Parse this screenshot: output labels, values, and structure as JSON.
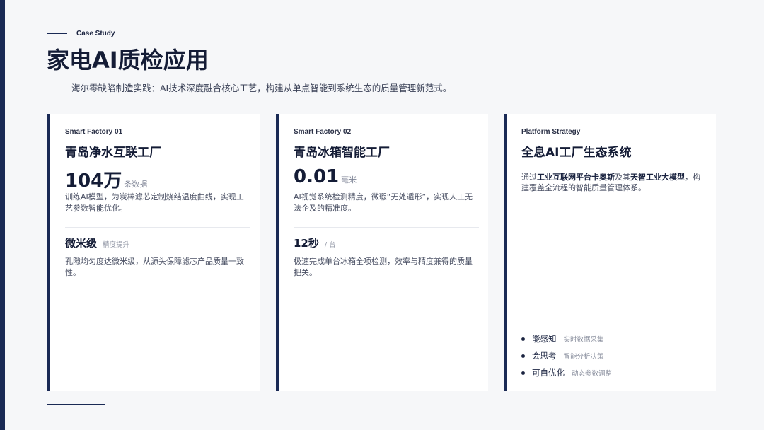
{
  "header": {
    "eyebrow": "Case Study",
    "title": "家电AI质检应用",
    "subtitle": "海尔零缺陷制造实践：AI技术深度融合核心工艺，构建从单点智能到系统生态的质量管理新范式。"
  },
  "cards": [
    {
      "label": "Smart Factory 01",
      "title": "青岛净水互联工厂",
      "metric_value": "104万",
      "metric_unit": "条数据",
      "description": "训练AI模型，为炭棒滤芯定制烧结温度曲线，实现工艺参数智能优化。",
      "metric2_value": "微米级",
      "metric2_unit": "精度提升",
      "description2": "孔隙均匀度达微米级，从源头保障滤芯产品质量一致性。"
    },
    {
      "label": "Smart Factory 02",
      "title": "青岛冰箱智能工厂",
      "metric_value": "0.01",
      "metric_unit": "毫米",
      "description": "AI视觉系统检测精度，微瑕“无处遁形”，实现人工无法企及的精准度。",
      "metric2_value": "12秒",
      "metric2_unit": "/ 台",
      "description2": "极速完成单台冰箱全项检测，效率与精度兼得的质量把关。"
    },
    {
      "label": "Platform Strategy",
      "title": "全息AI工厂生态系统",
      "desc_pre": "通过",
      "desc_b1": "工业互联网平台卡奥斯",
      "desc_mid": "及其",
      "desc_b2": "天智工业大模型",
      "desc_post": "，构建覆盖全流程的智能质量管理体系。",
      "bullets": [
        {
          "main": "能感知",
          "sub": "实时数据采集"
        },
        {
          "main": "会思考",
          "sub": "智能分析决策"
        },
        {
          "main": "可自优化",
          "sub": "动态参数调整"
        }
      ]
    }
  ],
  "colors": {
    "accent": "#1a2a55",
    "background": "#f6f7f9",
    "card": "#ffffff"
  }
}
